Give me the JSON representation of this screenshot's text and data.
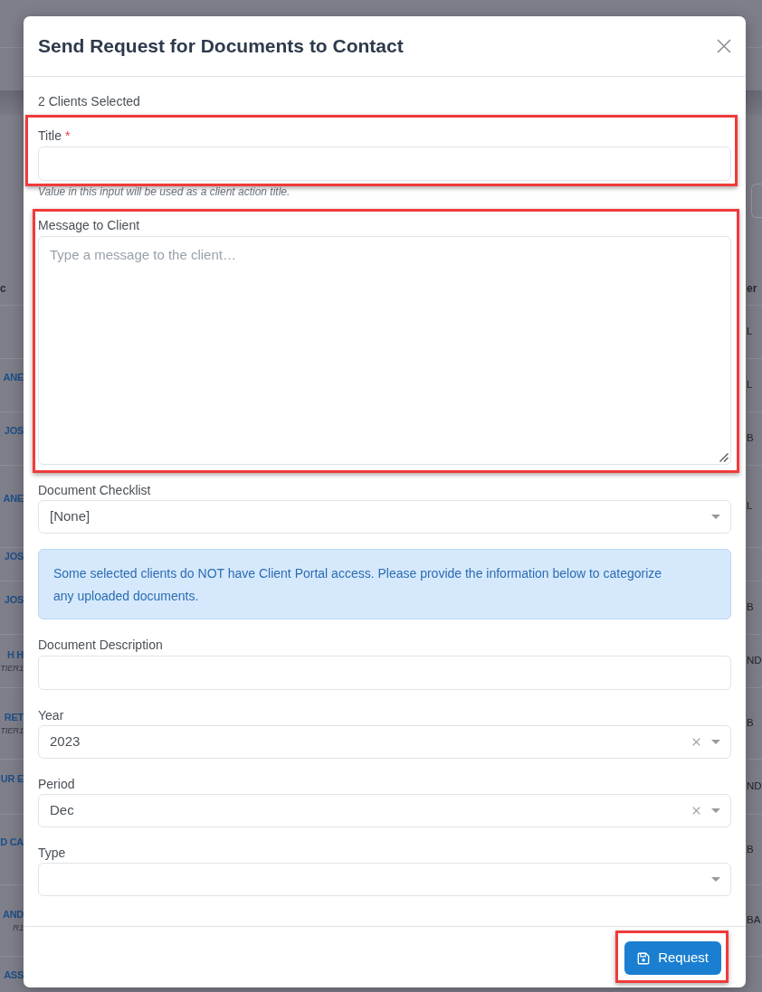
{
  "background_page": {
    "table": {
      "columns": [
        "c",
        "er"
      ],
      "rows": [
        {
          "column_2": "L"
        },
        {
          "column_1": "ANE",
          "column_2": "L"
        },
        {
          "column_1": "JOS",
          "column_2": "B"
        },
        {
          "column_1": "ANE",
          "column_2": "L"
        },
        {
          "column_1": "JOS"
        },
        {
          "column_1": "JOS",
          "column_2": "B"
        },
        {
          "column_1": "H H",
          "column_1_note": "TIER1",
          "column_2": "ND"
        },
        {
          "column_1": "RET",
          "column_1_note": "TIER1",
          "column_2": "B"
        },
        {
          "column_1": "UR E",
          "column_2": "ND"
        },
        {
          "column_1": "D CA",
          "column_2": "B"
        },
        {
          "column_1": "AND",
          "column_1_note": "R1",
          "column_2": "BA"
        },
        {
          "column_1": "ASS"
        }
      ]
    }
  },
  "dialog": {
    "title": "Send Request for Documents to Contact",
    "selection_count": "2 Clients Selected",
    "fields": [
      {
        "kind": "text",
        "label": "Title",
        "required_mark": "*",
        "highlighted": true,
        "help": "Value in this input will be used as a client action title."
      },
      {
        "kind": "textarea",
        "label": "Message to Client",
        "placeholder": "Type a message to the client…",
        "highlighted": true
      },
      {
        "kind": "select",
        "label": "Document Checklist",
        "value": "[None]",
        "clearable": false,
        "highlighted": false
      },
      {
        "kind": "alert",
        "text": "Some selected clients do NOT have Client Portal access. Please provide the information below to categorize any uploaded documents."
      },
      {
        "kind": "text",
        "label": "Document Description",
        "highlighted": false
      },
      {
        "kind": "select",
        "label": "Year",
        "value": "2023",
        "clearable": true,
        "highlighted": false
      },
      {
        "kind": "select",
        "label": "Period",
        "value": "Dec",
        "clearable": true,
        "highlighted": false
      },
      {
        "kind": "select",
        "label": "Type",
        "clearable": false,
        "highlighted": false
      }
    ],
    "footer_buttons": [
      {
        "label": "Request",
        "highlighted": true
      }
    ]
  }
}
